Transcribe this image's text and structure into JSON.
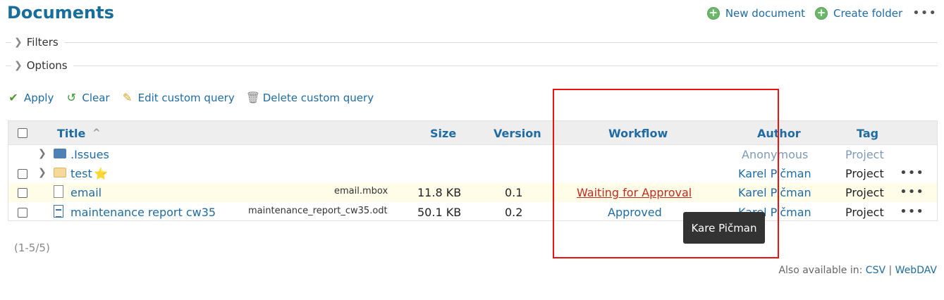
{
  "page": {
    "title": "Documents"
  },
  "top_actions": {
    "new_document": "New document",
    "create_folder": "Create folder",
    "more": "•••"
  },
  "sections": {
    "filters": "Filters",
    "options": "Options"
  },
  "query_actions": {
    "apply": "Apply",
    "clear": "Clear",
    "edit_custom_query": "Edit custom query",
    "delete_custom_query": "Delete custom query"
  },
  "table": {
    "columns": {
      "title": "Title",
      "sort_indicator": "^",
      "size": "Size",
      "version": "Version",
      "workflow": "Workflow",
      "author": "Author",
      "tag": "Tag"
    },
    "rows": [
      {
        "title": ".Issues",
        "filename": "",
        "size": "",
        "version": "",
        "workflow": "",
        "author": "Anonymous",
        "tag": "Project",
        "type": "folder-blue"
      },
      {
        "title": "test",
        "filename": "",
        "size": "",
        "version": "",
        "workflow": "",
        "author": "Karel Pičman",
        "tag": "Project",
        "type": "folder-yellow",
        "starred": "⭐"
      },
      {
        "title": "email",
        "filename": "email.mbox",
        "size": "11.8 KB",
        "version": "0.1",
        "workflow": "Waiting for Approval",
        "author": "Karel Pičman",
        "tag": "Project",
        "type": "file"
      },
      {
        "title": "maintenance report cw35",
        "filename": "maintenance_report_cw35.odt",
        "size": "50.1 KB",
        "version": "0.2",
        "workflow": "Approved",
        "author": "Karel Pičman",
        "tag": "Project",
        "type": "report"
      }
    ],
    "row_menu": "•••"
  },
  "pagination": "(1-5/5)",
  "also_available": {
    "label": "Also available in:",
    "csv": "CSV",
    "separator": "|",
    "webdav": "WebDAV"
  },
  "tooltip": "Kare Pičman",
  "colors": {
    "link": "#1f6ba3",
    "title": "#186e9a",
    "waiting": "#c52a1d",
    "highlight_box": "#ee1111"
  }
}
